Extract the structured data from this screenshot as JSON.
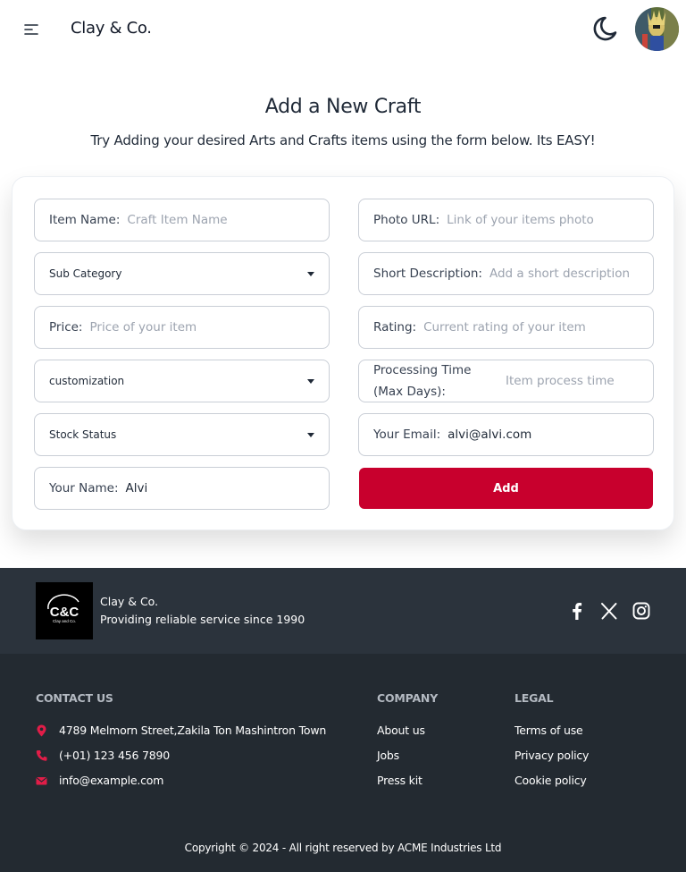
{
  "header": {
    "brand": "Clay & Co.",
    "menu_icon": "menu-icon",
    "theme_icon": "moon-icon"
  },
  "main": {
    "title": "Add a New Craft",
    "subtitle": "Try Adding your desired Arts and Crafts items using the form below. Its EASY!"
  },
  "form": {
    "item_name": {
      "label": "Item Name:",
      "placeholder": "Craft Item Name"
    },
    "photo_url": {
      "label": "Photo URL:",
      "placeholder": "Link of your items photo"
    },
    "sub_category": {
      "selected": "Sub Category"
    },
    "short_description": {
      "label": "Short Description:",
      "placeholder": "Add a short description"
    },
    "price": {
      "label": "Price:",
      "placeholder": "Price of your item"
    },
    "rating": {
      "label": "Rating:",
      "placeholder": "Current rating of your item"
    },
    "customization": {
      "selected": "customization"
    },
    "processing_time": {
      "label": "Processing Time (Max Days):",
      "placeholder": "Item process time"
    },
    "stock_status": {
      "selected": "Stock Status"
    },
    "email": {
      "label": "Your Email:",
      "value": "alvi@alvi.com"
    },
    "name": {
      "label": "Your Name:",
      "value": "Alvi"
    },
    "submit_label": "Add",
    "accent_color": "#c8002d"
  },
  "footer": {
    "brand": "Clay & Co.",
    "tagline": "Providing reliable service since 1990",
    "logo_text": "C&C",
    "logo_subtext": "Clay and Co.",
    "social_icons": [
      "facebook-icon",
      "x-icon",
      "instagram-icon"
    ],
    "contact": {
      "heading": "CONTACT US",
      "address": "4789 Melmorn Street,Zakila Ton Mashintron Town",
      "phone": "(+01) 123 456 7890",
      "email": "info@example.com"
    },
    "company": {
      "heading": "COMPANY",
      "links": [
        "About us",
        "Jobs",
        "Press kit"
      ]
    },
    "legal": {
      "heading": "LEGAL",
      "links": [
        "Terms of use",
        "Privacy policy",
        "Cookie policy"
      ]
    },
    "copyright": "Copyright © 2024 - All right reserved by ACME Industries Ltd"
  }
}
